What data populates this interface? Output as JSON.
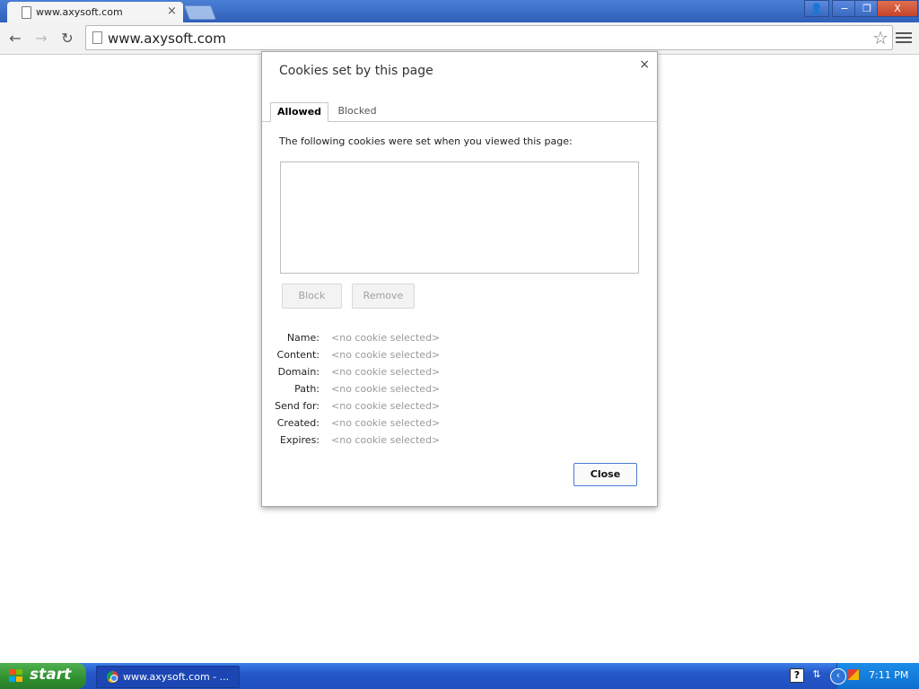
{
  "browser": {
    "tab_title": "www.axysoft.com",
    "tab_close": "×",
    "url": "www.axysoft.com",
    "window_controls": {
      "profile": "👤",
      "minimize": "−",
      "restore": "❐",
      "close": "X"
    },
    "nav": {
      "back": "←",
      "forward": "→",
      "reload": "↻"
    },
    "star": "☆"
  },
  "dialog": {
    "title": "Cookies set by this page",
    "close": "×",
    "tabs": {
      "allowed": "Allowed",
      "blocked": "Blocked"
    },
    "description": "The following cookies were set when you viewed this page:",
    "buttons": {
      "block": "Block",
      "remove": "Remove",
      "close": "Close"
    },
    "details": [
      {
        "label": "Name:",
        "value": "<no cookie selected>"
      },
      {
        "label": "Content:",
        "value": "<no cookie selected>"
      },
      {
        "label": "Domain:",
        "value": "<no cookie selected>"
      },
      {
        "label": "Path:",
        "value": "<no cookie selected>"
      },
      {
        "label": "Send for:",
        "value": "<no cookie selected>"
      },
      {
        "label": "Created:",
        "value": "<no cookie selected>"
      },
      {
        "label": "Expires:",
        "value": "<no cookie selected>"
      }
    ]
  },
  "taskbar": {
    "start_label": "start",
    "task_label": "www.axysoft.com - ...",
    "tray_help": "?",
    "clock": "7:11 PM"
  }
}
